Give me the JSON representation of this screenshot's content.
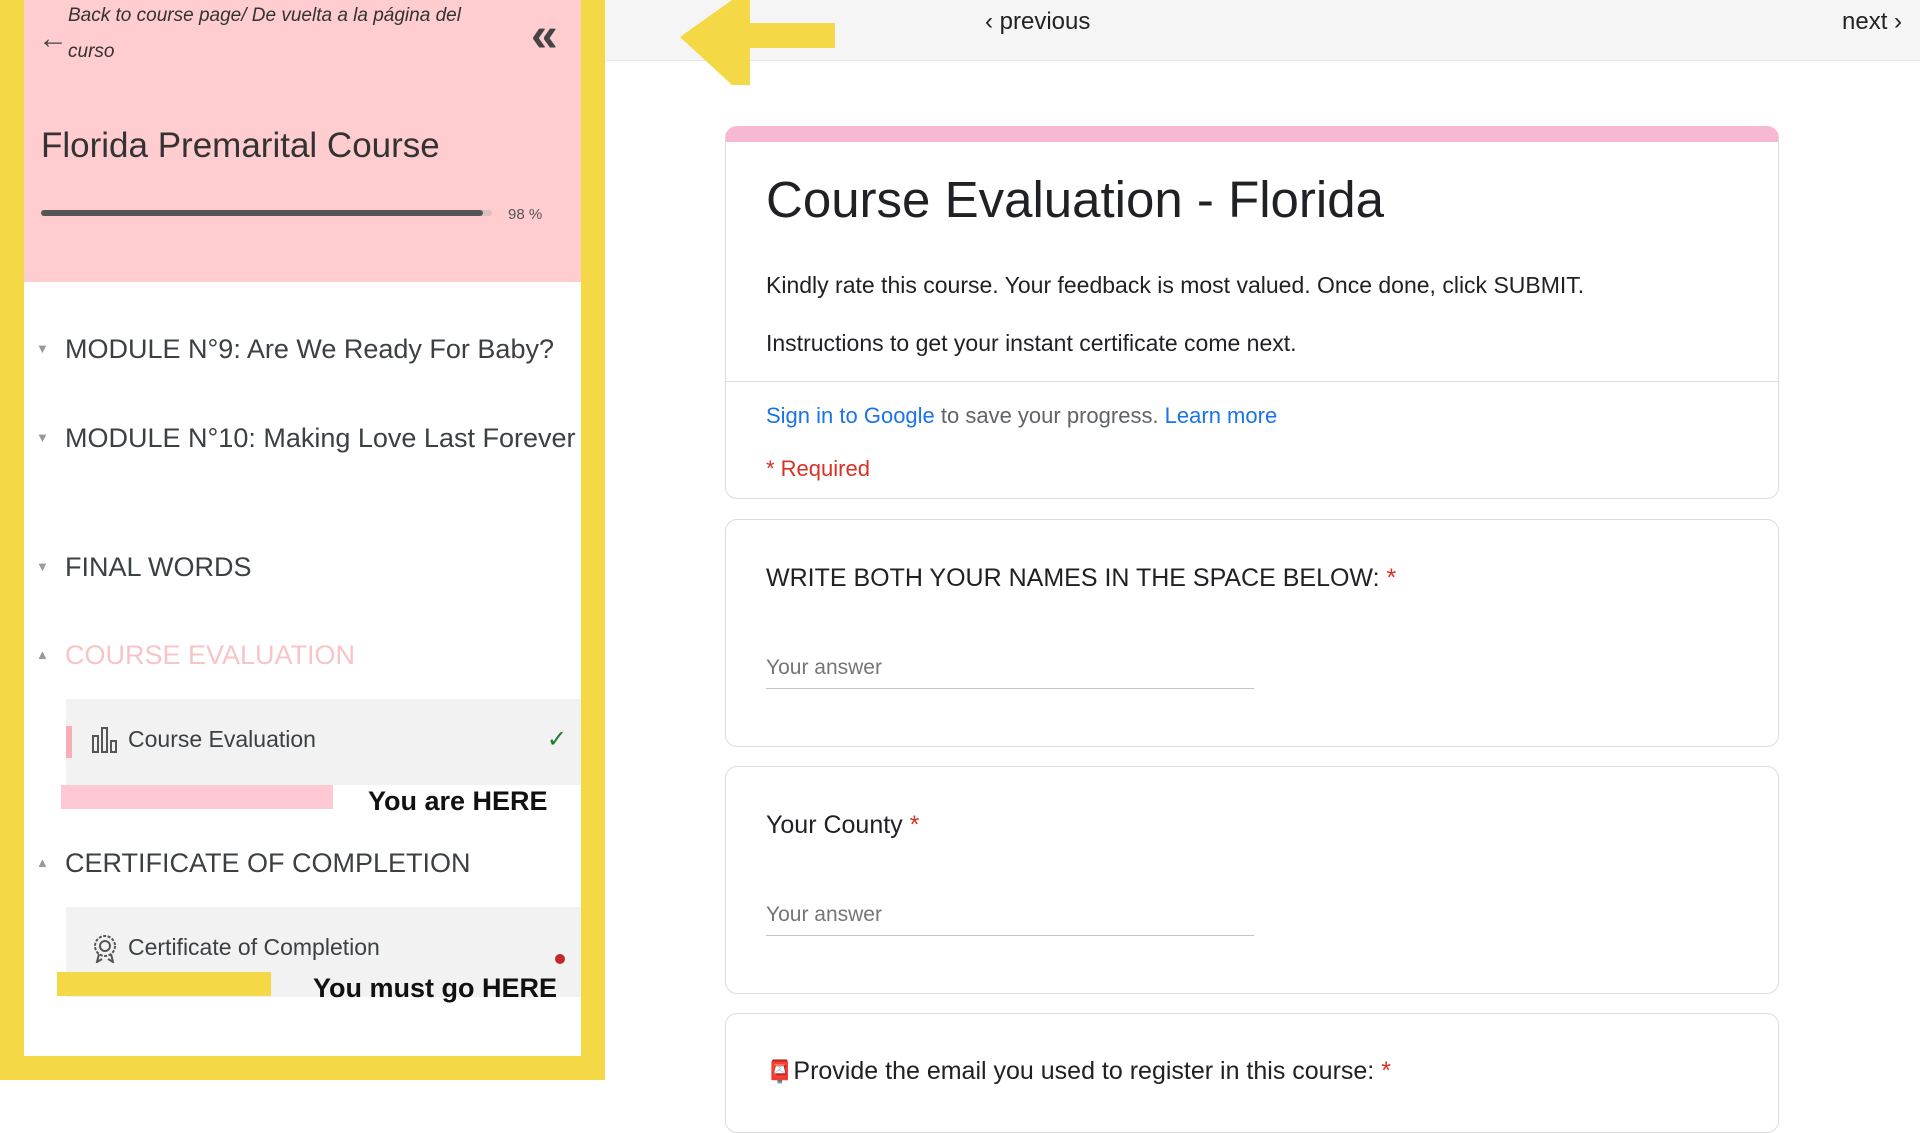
{
  "sidebar": {
    "back_icon": "arrow-left-icon",
    "back_link_line1": "Back to course page/ De vuelta a la página del",
    "back_link_line2": "curso",
    "collapse_icon": "double-chevron-left-icon",
    "collapse_glyph": "«",
    "course_title": "Florida Premarital Course",
    "progress": {
      "value": 0.98,
      "label": "98 %"
    },
    "modules": [
      {
        "label": "MODULE N°9: Are We Ready For Baby?",
        "state": "collapsed"
      },
      {
        "label": "MODULE N°10: Making Love Last Forever",
        "state": "collapsed"
      },
      {
        "label": "FINAL WORDS",
        "state": "collapsed"
      },
      {
        "label": "COURSE EVALUATION",
        "state": "expanded"
      },
      {
        "label": "CERTIFICATE OF COMPLETION",
        "state": "expanded"
      }
    ],
    "lessons": {
      "evaluation": {
        "label": "Course Evaluation",
        "icon": "bar-chart-icon",
        "status": "✓"
      },
      "certificate": {
        "label": "Certificate of Completion",
        "icon": "award-badge-icon",
        "status": "incomplete"
      }
    },
    "annotations": {
      "here": "You are HERE",
      "go": "You must go HERE"
    }
  },
  "nav": {
    "previous": "‹ previous",
    "next": "next ›"
  },
  "form": {
    "title": "Course Evaluation - Florida",
    "description_1": "Kindly rate this course. Your feedback is most valued. Once done, click SUBMIT.",
    "description_2": "Instructions to get your instant certificate come next.",
    "signin_link": "Sign in to Google",
    "signin_text": " to save your progress. ",
    "learn_more": "Learn more",
    "required_note": "* Required",
    "questions": [
      {
        "title": "WRITE BOTH YOUR NAMES IN THE SPACE BELOW:",
        "required": "*",
        "placeholder": "Your answer"
      },
      {
        "title": "Your County",
        "required": "*",
        "placeholder": "Your answer"
      },
      {
        "title": "Provide the email you used to register in this course:",
        "required": "*",
        "icon": "mailbox-icon"
      }
    ]
  },
  "colors": {
    "sidebar_frame": "#f4d845",
    "sidebar_header": "#ffcccf",
    "form_accent": "#f6b8d3",
    "link": "#1a73e8",
    "required": "#d93025",
    "arrow": "#f4d845"
  }
}
